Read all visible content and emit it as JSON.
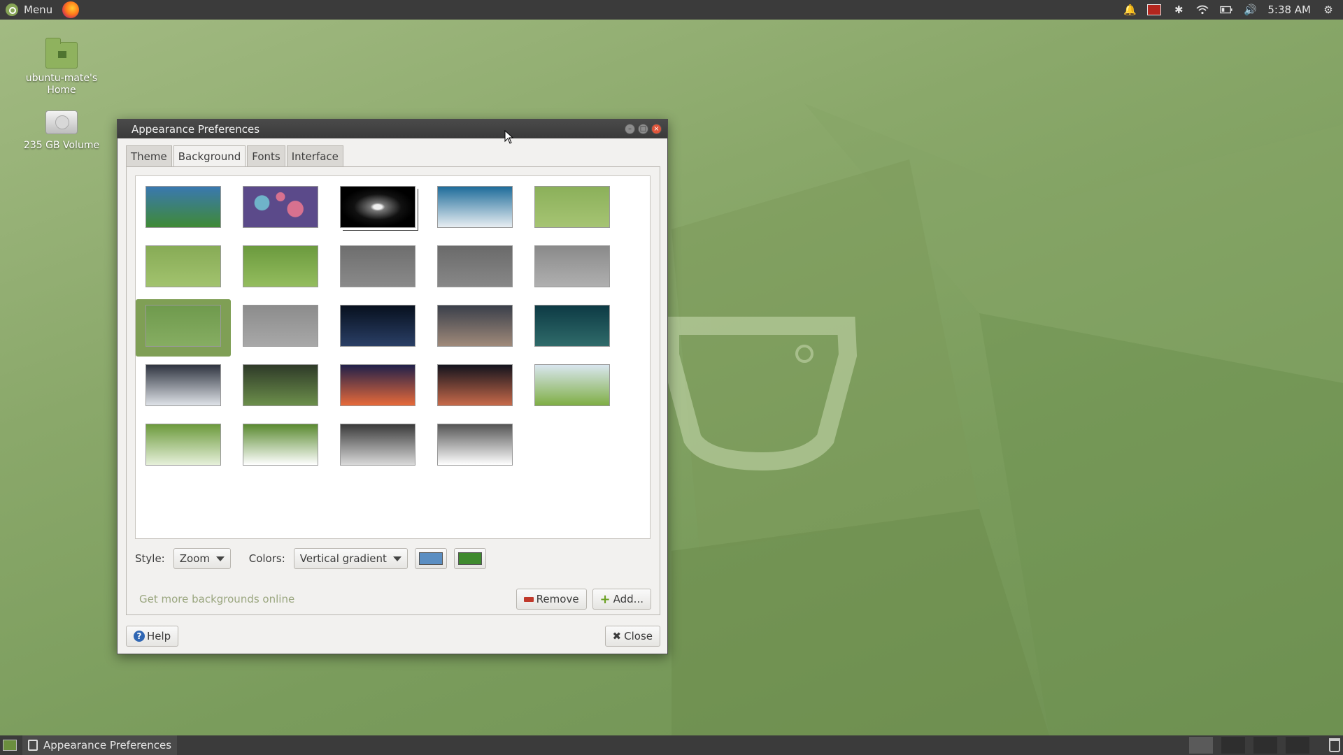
{
  "top_panel": {
    "menu_label": "Menu",
    "clock": "5:38 AM"
  },
  "desktop": {
    "icons": [
      {
        "label": "ubuntu-mate's Home"
      },
      {
        "label": "235 GB Volume"
      }
    ]
  },
  "window": {
    "title": "Appearance Preferences",
    "tabs": [
      {
        "label": "Theme"
      },
      {
        "label": "Background"
      },
      {
        "label": "Fonts"
      },
      {
        "label": "Interface"
      }
    ],
    "active_tab": "Background",
    "thumbnails": [
      {
        "name": "blue-green-gradient",
        "colors": [
          "#3a78b0",
          "#3f8a35"
        ]
      },
      {
        "name": "bokeh-lights",
        "colors": [
          "#5b4a8a",
          "#d7718f",
          "#6fb3c9"
        ]
      },
      {
        "name": "sombrero-galaxy",
        "colors": [
          "#000000",
          "#c8c8c8"
        ]
      },
      {
        "name": "ocean-waves",
        "colors": [
          "#1e6c9a",
          "#e8eef2"
        ]
      },
      {
        "name": "green-polygons",
        "colors": [
          "#8bb05a",
          "#a6c473"
        ]
      },
      {
        "name": "green-polygons-mate-logo",
        "colors": [
          "#87ab56",
          "#a2c36e"
        ]
      },
      {
        "name": "green-low-poly-logo",
        "colors": [
          "#6b9a3e",
          "#94bd5e"
        ]
      },
      {
        "name": "grey-polygons",
        "colors": [
          "#6e6e6e",
          "#8a8a8a"
        ]
      },
      {
        "name": "grey-polygons-mate-logo",
        "colors": [
          "#6a6a6a",
          "#888888"
        ]
      },
      {
        "name": "grey-low-poly-logo",
        "colors": [
          "#8a8a8a",
          "#b0b0b0"
        ]
      },
      {
        "name": "green-glasses",
        "colors": [
          "#6f9a4d",
          "#86ad62"
        ]
      },
      {
        "name": "grey-glasses",
        "colors": [
          "#8c8c8c",
          "#a8a8a8"
        ]
      },
      {
        "name": "earth-night",
        "colors": [
          "#07101e",
          "#2a3f66"
        ]
      },
      {
        "name": "half-dome",
        "colors": [
          "#3a3f4a",
          "#a08a7a"
        ]
      },
      {
        "name": "rainy-window",
        "colors": [
          "#0d3a44",
          "#2f6b6a"
        ]
      },
      {
        "name": "mountain-clouds",
        "colors": [
          "#2f3440",
          "#dfe3e8"
        ]
      },
      {
        "name": "green-cliffs",
        "colors": [
          "#2e3a28",
          "#6c8f4b"
        ]
      },
      {
        "name": "milky-way-sunset",
        "colors": [
          "#20204a",
          "#e86a3a"
        ]
      },
      {
        "name": "starry-mountain",
        "colors": [
          "#13131d",
          "#c86a4a"
        ]
      },
      {
        "name": "lone-tree",
        "colors": [
          "#d9e6ef",
          "#7fae44"
        ]
      },
      {
        "name": "green-circles-art",
        "colors": [
          "#6c9a3c",
          "#e6f0da"
        ]
      },
      {
        "name": "green-splash-art",
        "colors": [
          "#5a8a30",
          "#ffffff"
        ]
      },
      {
        "name": "grey-circles-art",
        "colors": [
          "#3a3a3a",
          "#d9d9d9"
        ]
      },
      {
        "name": "grey-splash-art",
        "colors": [
          "#555555",
          "#ffffff"
        ]
      }
    ],
    "selected_index": 10,
    "style_label": "Style:",
    "style_value": "Zoom",
    "colors_label": "Colors:",
    "colors_value": "Vertical gradient",
    "primary_color": "#5b8ec2",
    "secondary_color": "#3f8a2e",
    "get_more_link": "Get more backgrounds online",
    "remove_label": "Remove",
    "add_label": "Add...",
    "help_label": "Help",
    "close_label": "Close"
  },
  "taskbar": {
    "task_label": "Appearance Preferences"
  }
}
